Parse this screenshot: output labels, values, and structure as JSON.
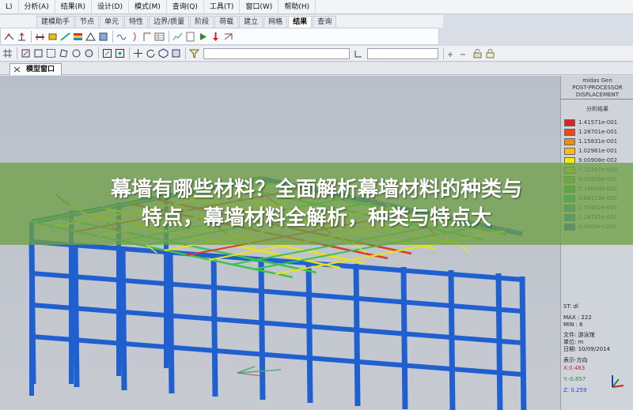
{
  "menu": {
    "items": [
      "L)",
      "分析(A)",
      "结果(R)",
      "设计(D)",
      "模式(M)",
      "查询(Q)",
      "工具(T)",
      "窗口(W)",
      "帮助(H)"
    ]
  },
  "ribbon_tabs": [
    "建模助手",
    "节点",
    "单元",
    "特性",
    "边界/质量",
    "阶段",
    "荷载",
    "建立",
    "网格",
    "结果",
    "查询"
  ],
  "active_tab": "结果",
  "document": {
    "tab_label": "模型窗口"
  },
  "legend": {
    "title_lines": [
      "midas Gen",
      "POST-PROCESSOR",
      "DISPLACEMENT"
    ],
    "subtitle": "分析结果",
    "entries": [
      {
        "value": "1.41571e-001",
        "color": "#d9261c"
      },
      {
        "value": "1.28701e-001",
        "color": "#e84a18"
      },
      {
        "value": "1.15831e-001",
        "color": "#f08a10"
      },
      {
        "value": "1.02961e-001",
        "color": "#f7c00c"
      },
      {
        "value": "9.00908e-002",
        "color": "#f0ea12"
      },
      {
        "value": "7.72207e-002",
        "color": "#b6e21a"
      },
      {
        "value": "6.43506e-002",
        "color": "#62d42a"
      },
      {
        "value": "5.14804e-002",
        "color": "#20c640"
      },
      {
        "value": "3.86103e-002",
        "color": "#17b888"
      },
      {
        "value": "2.57402e-002",
        "color": "#16a6c4"
      },
      {
        "value": "1.28701e-002",
        "color": "#1a8ede"
      },
      {
        "value": "0.0000e+000",
        "color": "#1c5fd6"
      }
    ],
    "st_label": "ST: dl",
    "max_label": "MAX : 222",
    "min_label": "MIN : 6",
    "file_label": "文件: 游泳馆",
    "unit_label": "单位: m",
    "date_label": "日期: 10/09/2014",
    "view_label": "表示-方向",
    "x_label": "X:0.483",
    "y_label": "Y:-0.857",
    "z_label": "Z: 0.259"
  },
  "banner": {
    "line1": "幕墙有哪些材料？全面解析幕墙材料的种类与",
    "line2": "特点，幕墙材料全解析，种类与特点大"
  },
  "colors": {
    "column_blue": "#1f5fd0",
    "truss_green": "#3fc24a",
    "truss_yellow": "#e8e21c",
    "truss_red": "#e03a1e",
    "banner_green": "#6ea046"
  }
}
